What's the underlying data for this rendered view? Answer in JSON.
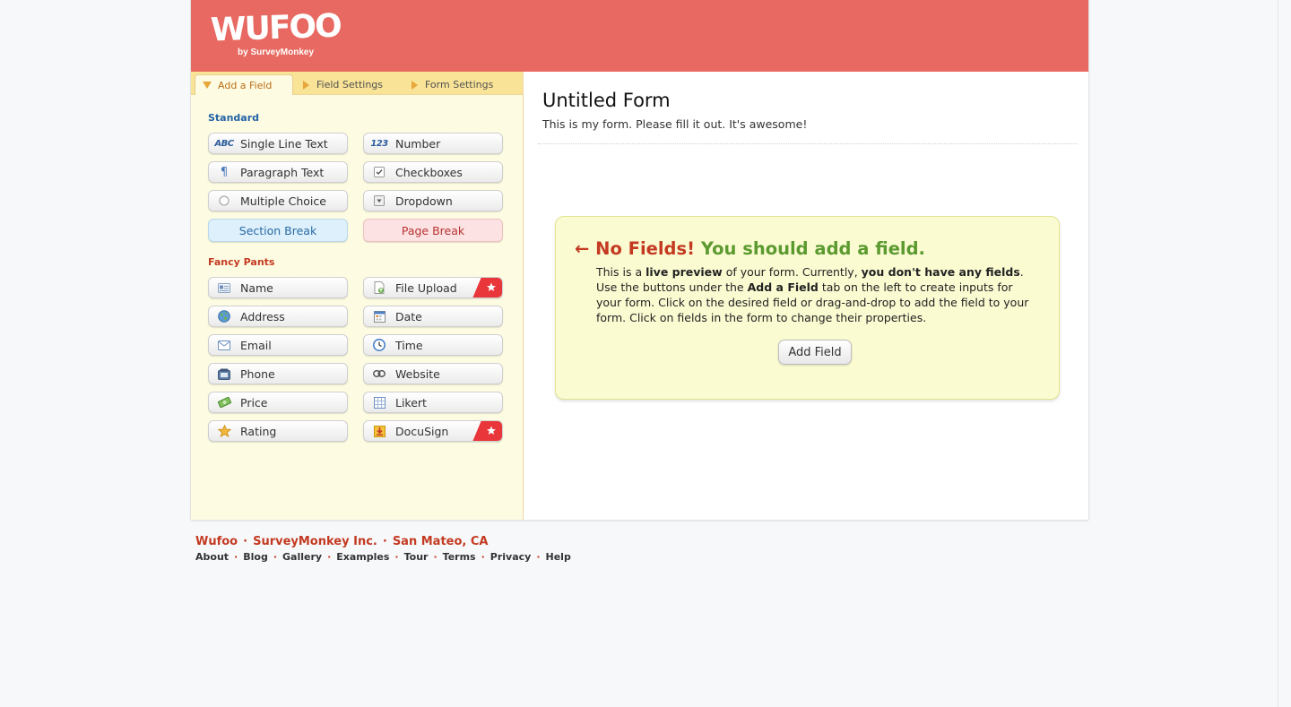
{
  "brand": {
    "logo_text": "WUFOO",
    "logo_sub": "by SurveyMonkey"
  },
  "tabs": [
    {
      "label": "Add a Field"
    },
    {
      "label": "Field Settings"
    },
    {
      "label": "Form Settings"
    }
  ],
  "sections": {
    "standard": "Standard",
    "fancy": "Fancy Pants"
  },
  "standard_fields": [
    {
      "label": "Single Line Text",
      "icon": "abc-icon"
    },
    {
      "label": "Number",
      "icon": "123-icon"
    },
    {
      "label": "Paragraph Text",
      "icon": "paragraph-icon"
    },
    {
      "label": "Checkboxes",
      "icon": "checkbox-icon"
    },
    {
      "label": "Multiple Choice",
      "icon": "radio-icon"
    },
    {
      "label": "Dropdown",
      "icon": "dropdown-icon"
    },
    {
      "label": "Section Break"
    },
    {
      "label": "Page Break"
    }
  ],
  "fancy_fields": [
    {
      "label": "Name",
      "icon": "name-card-icon"
    },
    {
      "label": "File Upload",
      "icon": "file-upload-icon",
      "badge": "star"
    },
    {
      "label": "Address",
      "icon": "globe-icon"
    },
    {
      "label": "Date",
      "icon": "calendar-icon"
    },
    {
      "label": "Email",
      "icon": "envelope-icon"
    },
    {
      "label": "Time",
      "icon": "clock-icon"
    },
    {
      "label": "Phone",
      "icon": "phone-icon"
    },
    {
      "label": "Website",
      "icon": "link-icon"
    },
    {
      "label": "Price",
      "icon": "money-icon"
    },
    {
      "label": "Likert",
      "icon": "likert-grid-icon"
    },
    {
      "label": "Rating",
      "icon": "star-icon"
    },
    {
      "label": "DocuSign",
      "icon": "docusign-icon",
      "badge": "star"
    }
  ],
  "form": {
    "title": "Untitled Form",
    "description": "This is my form. Please fill it out. It's awesome!"
  },
  "nofields": {
    "arrow": "←",
    "head_red": "No Fields!",
    "head_green": "You should add a field.",
    "t1": "This is a ",
    "b1": "live preview",
    "t2": " of your form. Currently, ",
    "b2": "you don't have any fields",
    "t3": ". Use the buttons under the ",
    "b3": "Add a Field",
    "t4": " tab on the left to create inputs for your form. Click on the desired field or drag-and-drop to add the field to your form. Click on fields in the form to change their properties.",
    "button": "Add Field"
  },
  "footer": {
    "company": [
      "Wufoo",
      "SurveyMonkey Inc.",
      "San Mateo, CA"
    ],
    "links": [
      "About",
      "Blog",
      "Gallery",
      "Examples",
      "Tour",
      "Terms",
      "Privacy",
      "Help"
    ]
  },
  "colors": {
    "header": "#e76961",
    "sidebar": "#fdfce2",
    "tabs": "#f9e397",
    "accent_red": "#c33a21",
    "accent_blue": "#2463a6",
    "accent_green": "#5b9a2f",
    "notice_bg": "#fbfbd2"
  }
}
